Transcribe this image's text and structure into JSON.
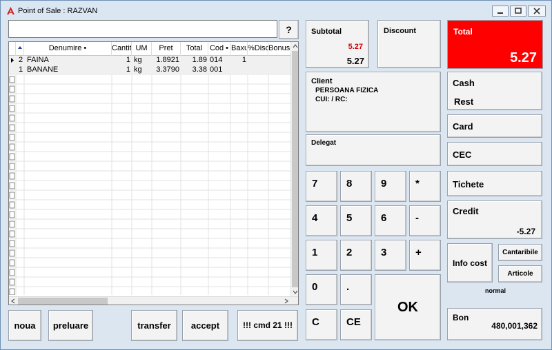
{
  "window": {
    "title": "Point of Sale : RAZVAN"
  },
  "search": {
    "value": "",
    "button_label": "?"
  },
  "grid": {
    "columns": [
      "Denumire",
      "Cantit",
      "UM",
      "Pret",
      "Total",
      "Cod",
      "Baxu",
      "%Disc",
      "Bonus"
    ],
    "rows": [
      {
        "nr": "2",
        "denumire": "FAINA",
        "cantit": "1",
        "um": "kg",
        "pret": "1.8921",
        "total": "1.89",
        "cod": "014",
        "baxu": "1",
        "disc": "",
        "bonus": ""
      },
      {
        "nr": "1",
        "denumire": "BANANE",
        "cantit": "1",
        "um": "kg",
        "pret": "3.3790",
        "total": "3.38",
        "cod": "001",
        "baxu": "",
        "disc": "",
        "bonus": ""
      }
    ]
  },
  "subtotal": {
    "label": "Subtotal",
    "red_value": "5.27",
    "value": "5.27"
  },
  "discount": {
    "label": "Discount"
  },
  "total": {
    "label": "Total",
    "value": "5.27",
    "color": "#ff0000"
  },
  "client": {
    "label": "Client",
    "name": "PERSOANA FIZICA",
    "cui": "CUI: / RC:"
  },
  "delegat": {
    "label": "Delegat"
  },
  "keypad": {
    "k7": "7",
    "k8": "8",
    "k9": "9",
    "kmul": "*",
    "k4": "4",
    "k5": "5",
    "k6": "6",
    "kminus": "-",
    "k1": "1",
    "k2": "2",
    "k3": "3",
    "kplus": "+",
    "k0": "0",
    "kdot": ".",
    "kc": "C",
    "kce": "CE",
    "ok": "OK"
  },
  "payments": {
    "cash": "Cash",
    "rest": "Rest",
    "card": "Card",
    "cec": "CEC",
    "tichete": "Tichete",
    "credit": "Credit",
    "credit_value": "-5.27",
    "info_cost": "Info cost",
    "cantaribile": "Cantaribile",
    "articole": "Articole",
    "mode": "normal",
    "bon": "Bon",
    "bon_value": "480,001,362"
  },
  "bottom": {
    "noua": "noua",
    "preluare": "preluare",
    "transfer": "transfer",
    "accept": "accept",
    "cmd": "!!! cmd 21 !!!"
  }
}
